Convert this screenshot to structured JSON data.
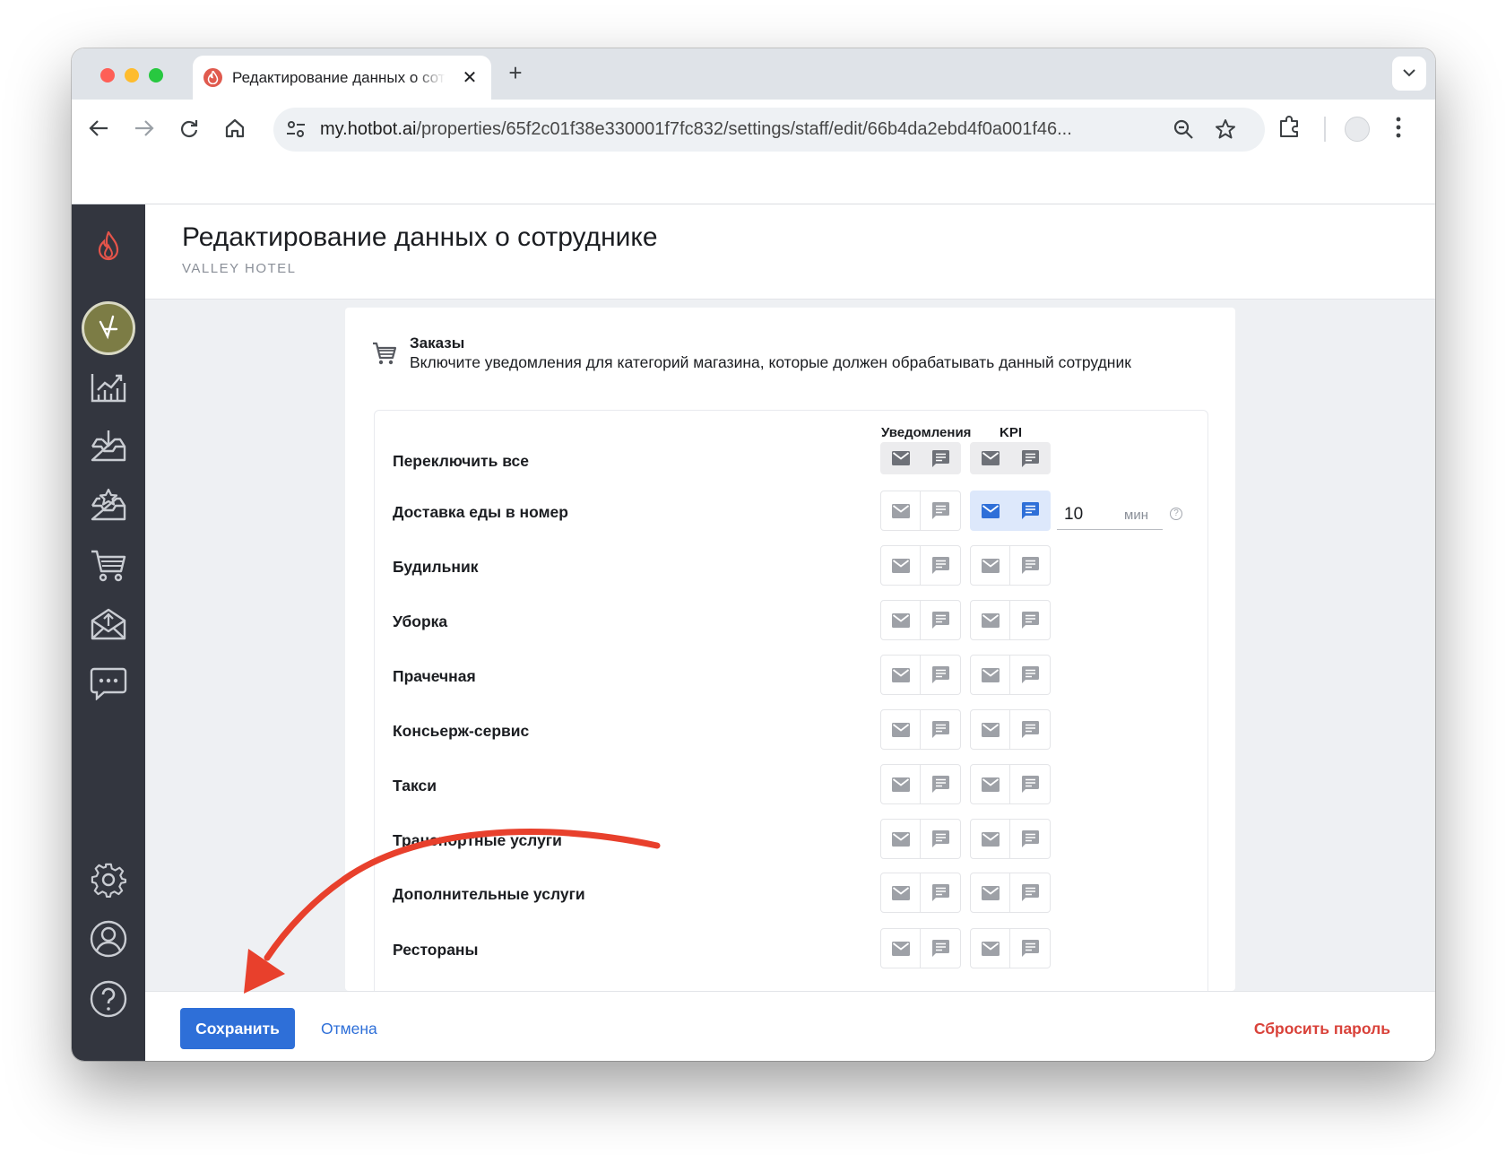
{
  "browser": {
    "tab_title": "Редактирование данных о сотруднике",
    "tab_close": "✕",
    "new_tab": "+",
    "url_host": "my.hotbot.ai",
    "url_path": "/properties/65f2c01f38e330001f7fc832/settings/staff/edit/66b4da2ebd4f0a001f46..."
  },
  "header": {
    "title": "Редактирование данных о сотруднике",
    "subtitle": "VALLEY HOTEL"
  },
  "section": {
    "title": "Заказы",
    "description": "Включите уведомления для категорий магазина, которые должен обрабатывать данный сотрудник"
  },
  "columns": {
    "notifications": "Уведомления",
    "kpi": "KPI"
  },
  "rows": [
    {
      "label": "Переключить все"
    },
    {
      "label": "Доставка еды в номер"
    },
    {
      "label": "Будильник"
    },
    {
      "label": "Уборка"
    },
    {
      "label": "Прачечная"
    },
    {
      "label": "Консьерж-сервис"
    },
    {
      "label": "Такси"
    },
    {
      "label": "Транспортные услуги"
    },
    {
      "label": "Дополнительные услуги"
    },
    {
      "label": "Рестораны"
    }
  ],
  "kpi_input": {
    "value": "10",
    "unit": "мин"
  },
  "footer": {
    "save": "Сохранить",
    "cancel": "Отмена",
    "reset_password": "Сбросить пароль"
  },
  "colors": {
    "primary": "#2e6fd8",
    "danger": "#d9423a",
    "sidebar": "#33363f",
    "annotation_arrow": "#e8402c"
  }
}
